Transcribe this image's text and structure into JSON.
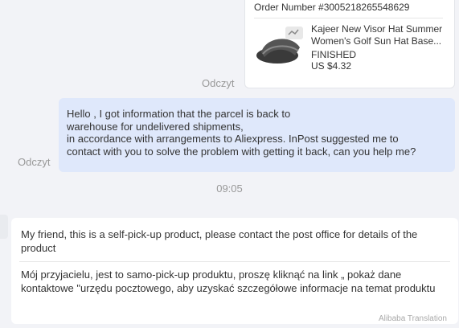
{
  "order_card": {
    "order_number": "Order Number #3005218265548629",
    "product_title": "Kajeer New Visor Hat Summer Women's Golf Sun Hat Base...",
    "status": "FINISHED",
    "price": "US $4.32"
  },
  "read_status_1": "Odczyt",
  "user_message": {
    "lines": [
      "Hello , I got information that the parcel is back to",
      "warehouse for undelivered shipments,",
      "in accordance with arrangements to Aliexpress. InPost suggested me to",
      "contact with you to solve the problem with getting it back, can you help me?"
    ]
  },
  "read_status_2": "Odczyt",
  "timestamp": "09:05",
  "seller_message": {
    "english": "My friend, this is a self-pick-up product, please contact the post office for details of the product",
    "polish": "Mój przyjacielu, jest to samo-pick-up produktu, proszę kliknąć na link „ pokaż dane kontaktowe \"urzędu pocztowego, aby uzyskać szczegółowe informacje na temat produktu",
    "translation_credit": "Alibaba Translation"
  }
}
